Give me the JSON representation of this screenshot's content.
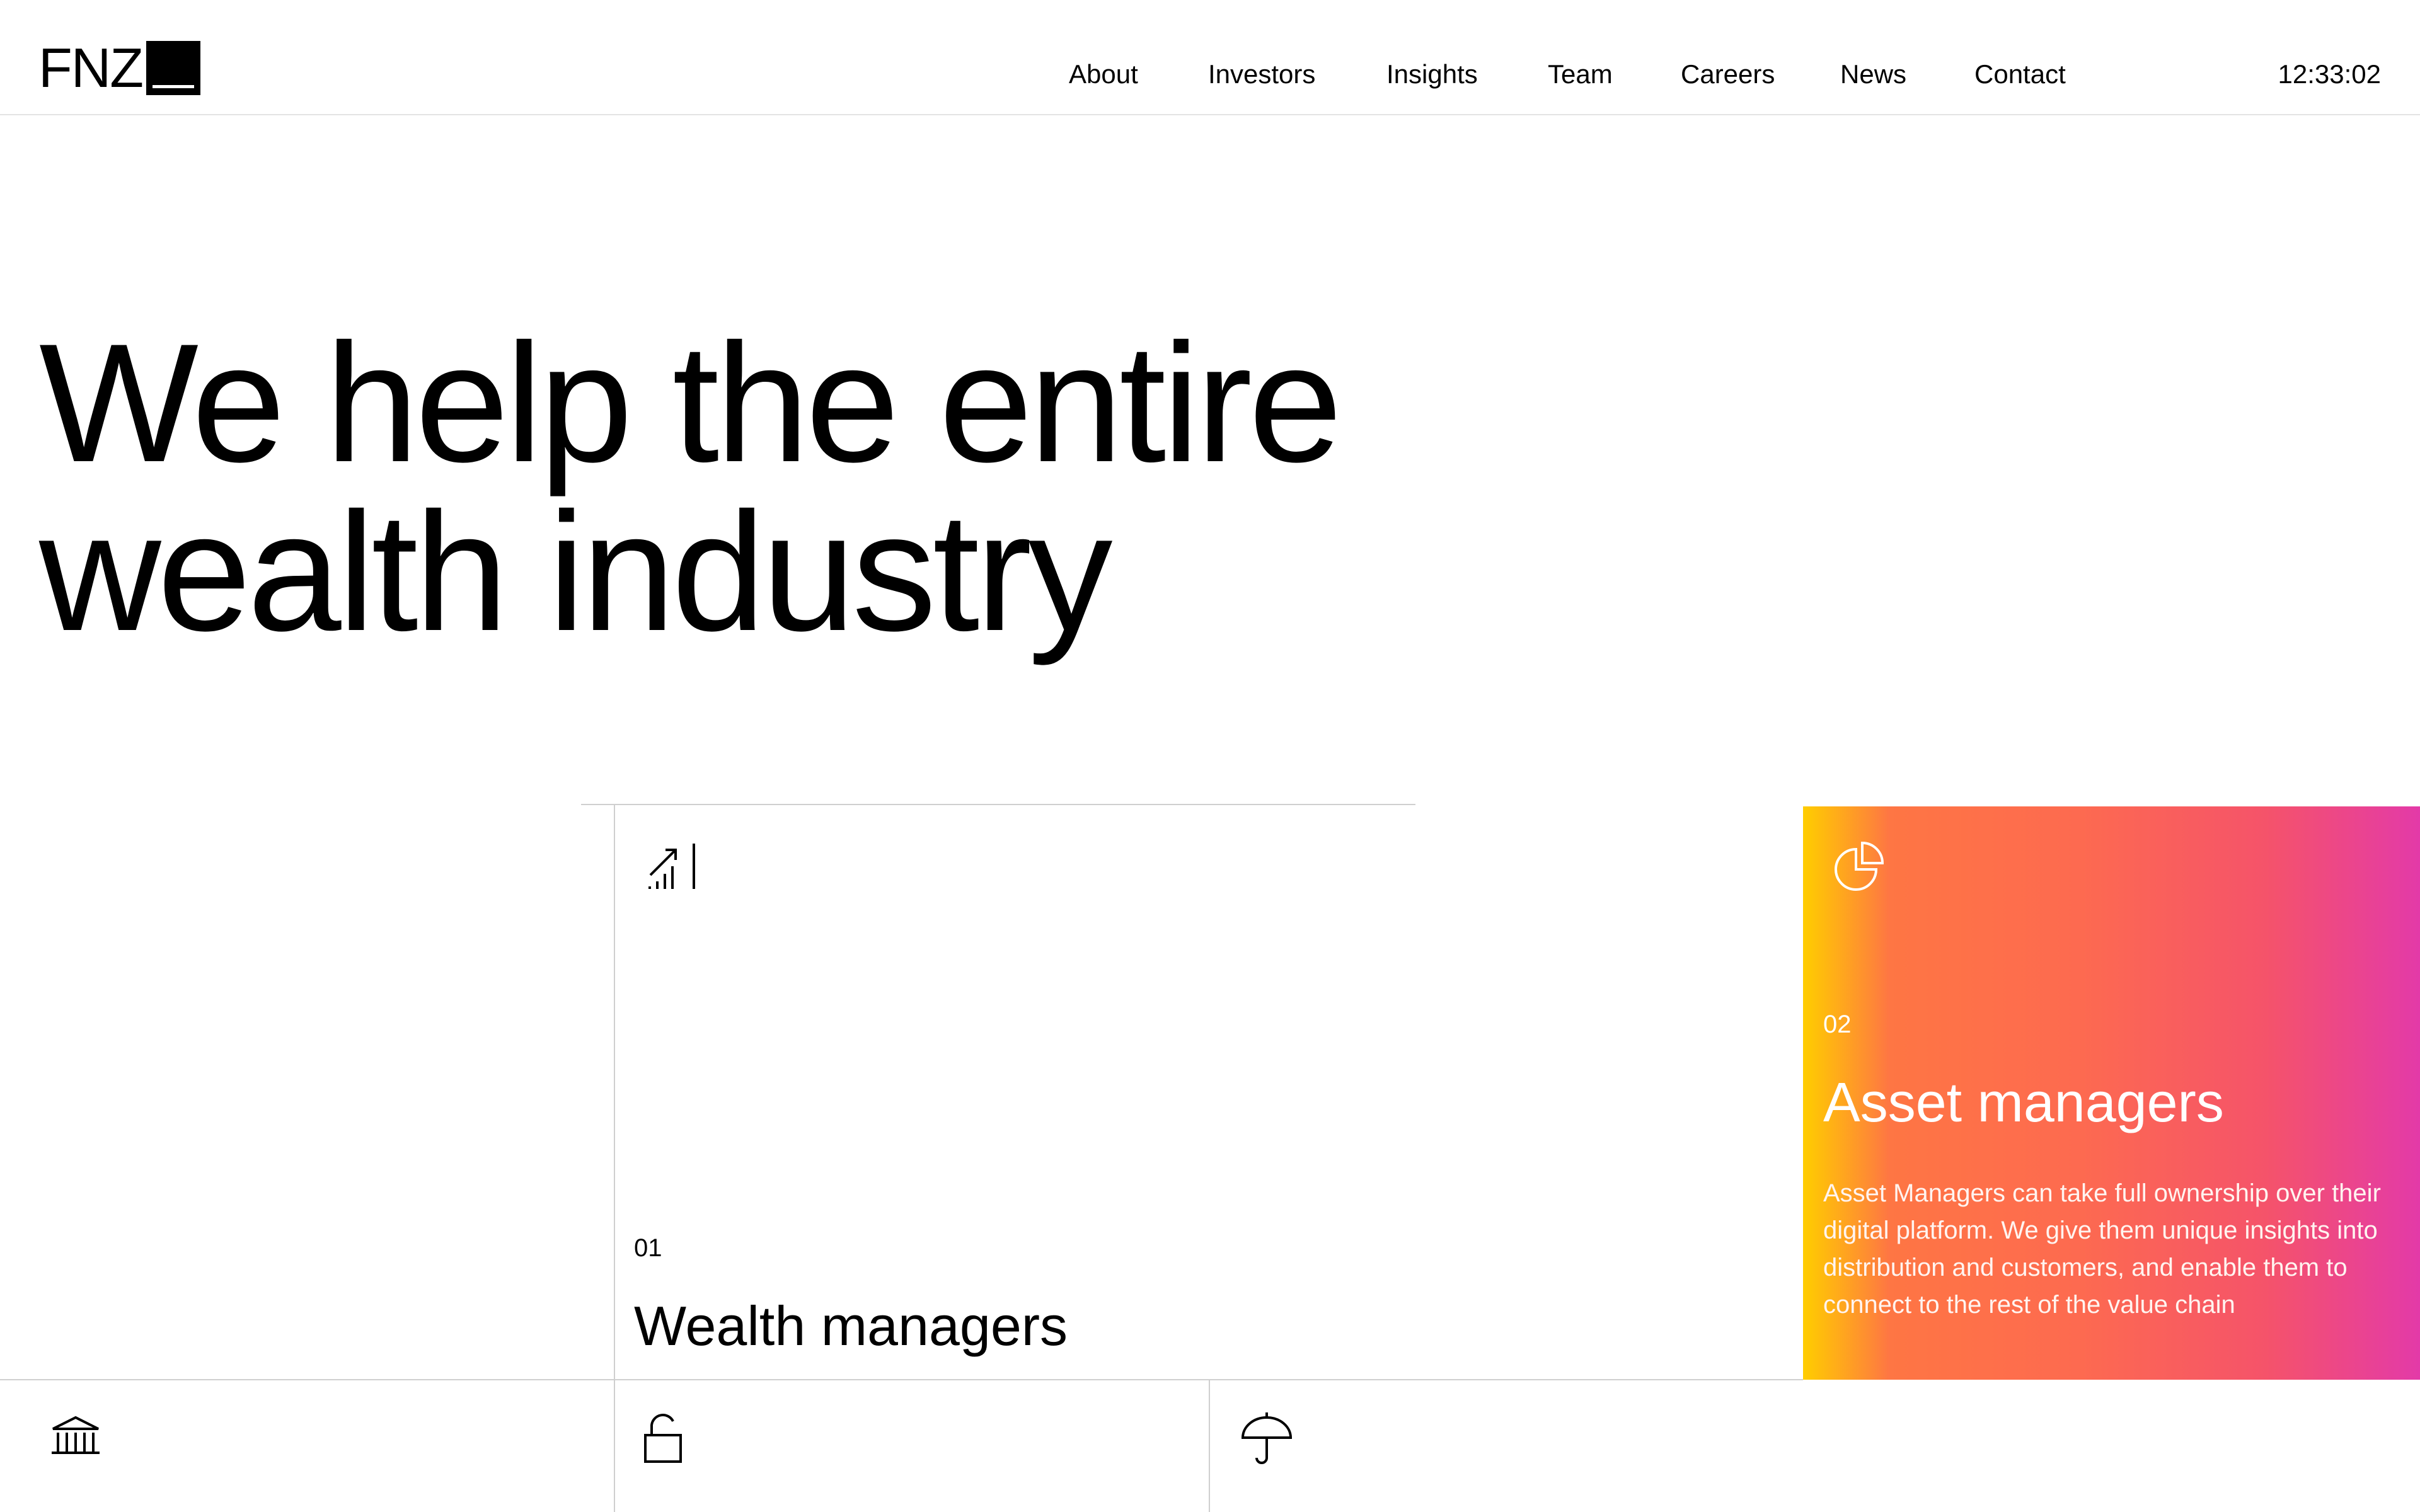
{
  "header": {
    "logo_text": "FNZ",
    "nav": [
      {
        "label": "About"
      },
      {
        "label": "Investors"
      },
      {
        "label": "Insights"
      },
      {
        "label": "Team"
      },
      {
        "label": "Careers"
      },
      {
        "label": "News"
      },
      {
        "label": "Contact"
      }
    ],
    "clock": "12:33:02"
  },
  "hero": {
    "line1": "We help the entire",
    "line2": "wealth industry"
  },
  "cards": {
    "wealth": {
      "icon": "signal-bars-icon",
      "number": "01",
      "title": "Wealth managers"
    },
    "asset": {
      "icon": "pie-chart-icon",
      "number": "02",
      "title": "Asset managers",
      "description": "Asset Managers can take full ownership over their digital platform. We give them unique insights into distribution and customers, and enable them to connect to the rest of the value chain",
      "gradient": [
        "#ffd000",
        "#ff7b3e",
        "#f5536a",
        "#e33aa8"
      ]
    }
  },
  "bottom_row": [
    {
      "icon": "bank-icon"
    },
    {
      "icon": "unlock-icon"
    },
    {
      "icon": "umbrella-icon"
    }
  ],
  "colors": {
    "text": "#000000",
    "background": "#ffffff",
    "rule": "#cfcfcf"
  }
}
